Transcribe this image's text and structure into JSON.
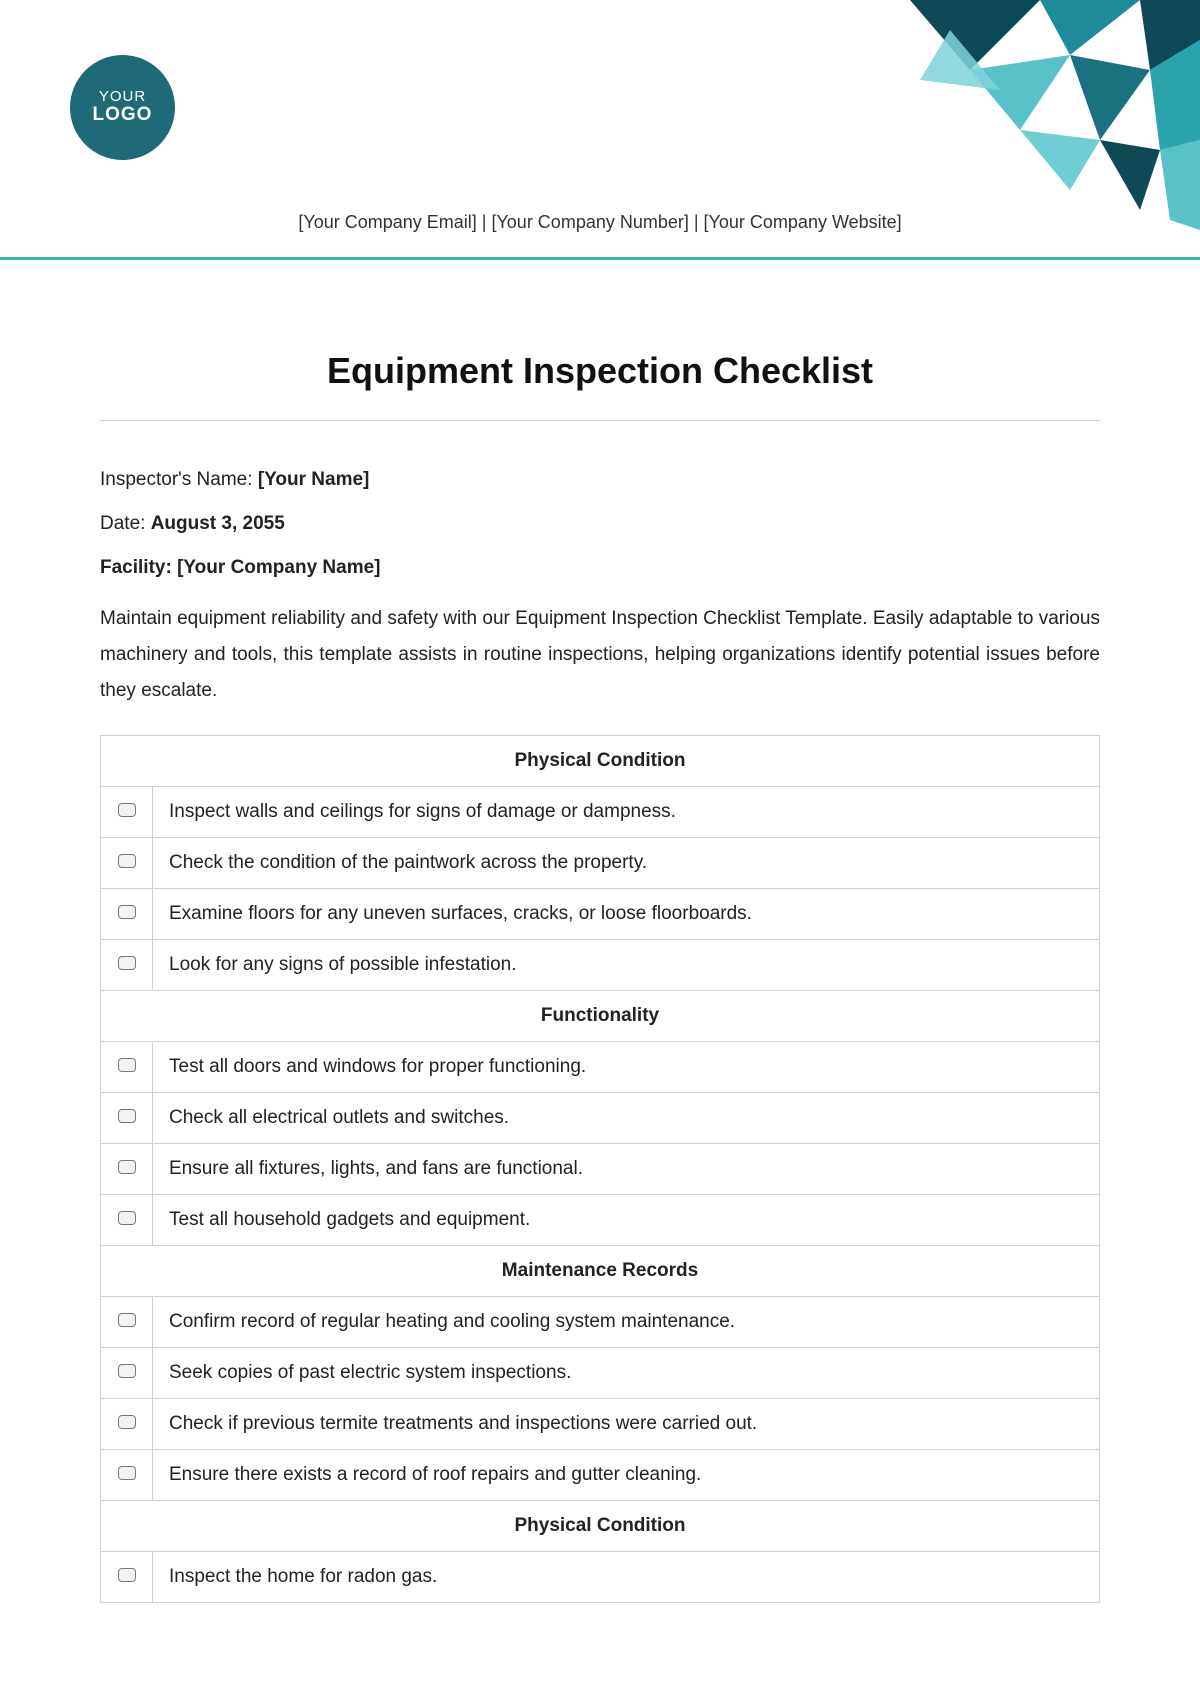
{
  "logo": {
    "line1": "YOUR",
    "line2": "LOGO"
  },
  "company_line": "[Your Company Email] | [Your Company Number] | [Your Company Website]",
  "title": "Equipment Inspection Checklist",
  "meta": {
    "inspector_label": "Inspector's Name: ",
    "inspector_value": "[Your Name]",
    "date_label": "Date: ",
    "date_value": "August 3, 2055",
    "facility_label": "Facility",
    "facility_sep": ": ",
    "facility_value": "[Your Company Name]"
  },
  "description": "Maintain equipment reliability and safety with our Equipment Inspection Checklist Template. Easily adaptable to various machinery and tools, this template assists in routine inspections, helping organizations identify potential issues before they escalate.",
  "sections": [
    {
      "heading": "Physical Condition",
      "items": [
        "Inspect walls and ceilings for signs of damage or dampness.",
        "Check the condition of the paintwork across the property.",
        "Examine floors for any uneven surfaces, cracks, or loose floorboards.",
        "Look for any signs of possible infestation."
      ]
    },
    {
      "heading": "Functionality",
      "items": [
        "Test all doors and windows for proper functioning.",
        "Check all electrical outlets and switches.",
        "Ensure all fixtures, lights, and fans are functional.",
        "Test all household gadgets and equipment."
      ]
    },
    {
      "heading": "Maintenance Records",
      "items": [
        "Confirm record of regular heating and cooling system maintenance.",
        "Seek copies of past electric system inspections.",
        "Check if previous termite treatments and inspections were carried out.",
        "Ensure there exists a record of roof repairs and gutter cleaning."
      ]
    },
    {
      "heading": "Physical Condition",
      "items": [
        "Inspect the home for radon gas."
      ]
    }
  ]
}
